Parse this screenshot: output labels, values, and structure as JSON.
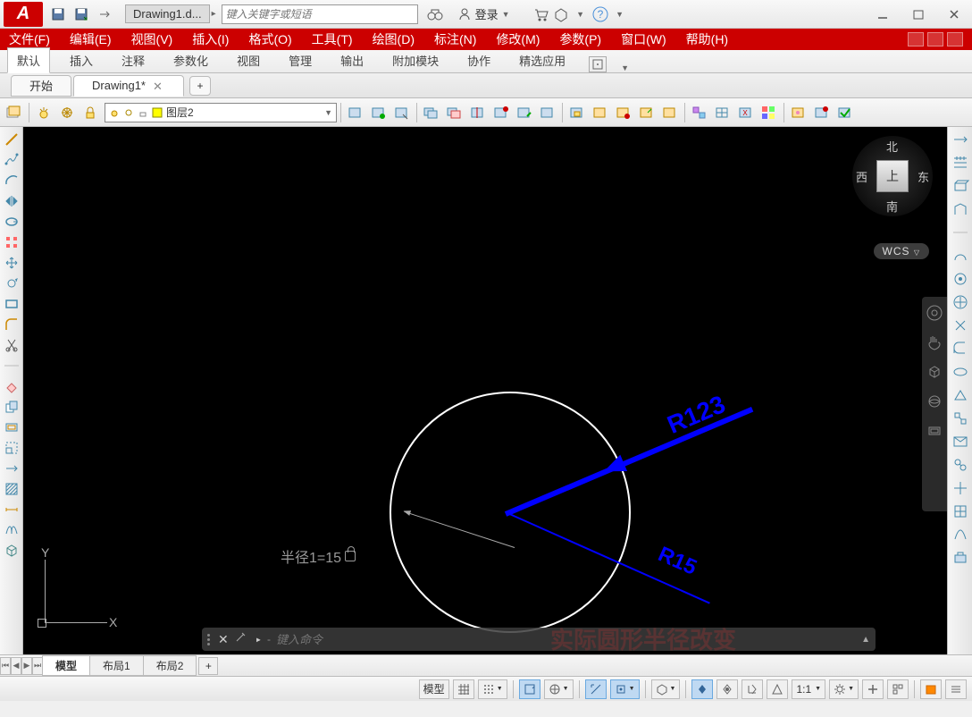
{
  "title": {
    "doc_short": "Drawing1.d...",
    "search_placeholder": "键入关键字或短语",
    "login": "登录"
  },
  "menubar": [
    "文件(F)",
    "编辑(E)",
    "视图(V)",
    "插入(I)",
    "格式(O)",
    "工具(T)",
    "绘图(D)",
    "标注(N)",
    "修改(M)",
    "参数(P)",
    "窗口(W)",
    "帮助(H)"
  ],
  "ribbon_tabs": [
    "默认",
    "插入",
    "注释",
    "参数化",
    "视图",
    "管理",
    "输出",
    "附加模块",
    "协作",
    "精选应用"
  ],
  "file_tabs": {
    "tab1": "开始",
    "tab2": "Drawing1*"
  },
  "layer": {
    "current": "图层2"
  },
  "canvas": {
    "viewcube": {
      "top": "上",
      "n": "北",
      "s": "南",
      "e": "东",
      "w": "西"
    },
    "wcs": "WCS",
    "radius_label": "半径1=15",
    "dim1": "R123",
    "dim2": "R15",
    "note": "实际圆形半径改变",
    "ucs_x": "X",
    "ucs_y": "Y",
    "cmd_prompt": "▸",
    "cmd_placeholder": "键入命令"
  },
  "layout_tabs": {
    "model": "模型",
    "l1": "布局1",
    "l2": "布局2"
  },
  "status": {
    "mode": "模型",
    "scale": "1:1"
  }
}
